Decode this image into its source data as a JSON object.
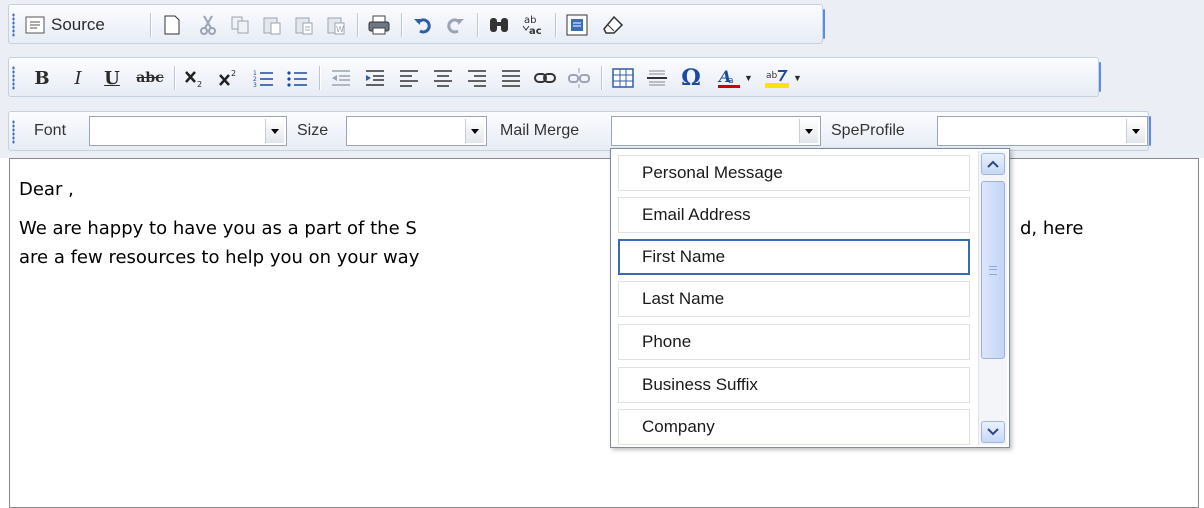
{
  "toolbar": {
    "source_label": "Source",
    "font_label": "Font",
    "size_label": "Size",
    "mail_merge_label": "Mail Merge",
    "speprofile_label": "SpeProfile",
    "font_value": "",
    "size_value": "",
    "mail_merge_value": "",
    "speprofile_value": "",
    "bold_glyph": "B",
    "italic_glyph": "I",
    "underline_glyph": "U",
    "strike_glyph": "abc",
    "omega_glyph": "Ω",
    "icons_row1": [
      "source-icon",
      "new-page-icon",
      "cut-icon",
      "copy-icon",
      "paste-icon",
      "paste-text-icon",
      "paste-word-icon",
      "print-icon",
      "undo-icon",
      "redo-icon",
      "find-icon",
      "replace-icon",
      "select-all-icon",
      "remove-format-icon"
    ],
    "icons_row2": [
      "bold-icon",
      "italic-icon",
      "underline-icon",
      "strikethrough-icon",
      "subscript-icon",
      "superscript-icon",
      "numbered-list-icon",
      "bulleted-list-icon",
      "outdent-icon",
      "indent-icon",
      "align-left-icon",
      "align-center-icon",
      "align-right-icon",
      "justify-icon",
      "link-icon",
      "unlink-icon",
      "table-icon",
      "horizontal-rule-icon",
      "special-char-icon",
      "text-color-icon",
      "bg-color-icon"
    ]
  },
  "editor": {
    "greeting": "Dear ,",
    "para_line1": "We are happy to have you as a part of the S",
    "para_line1_tail": "d, here",
    "para_line2": "are a few resources to help you on your way"
  },
  "mail_merge_dropdown": {
    "selected_index": 2,
    "items": [
      "Personal Message",
      "Email Address",
      "First Name",
      "Last Name",
      "Phone",
      "Business Suffix",
      "Company"
    ]
  },
  "colors": {
    "toolbar_bg": "#ebeef4",
    "toolbar_accent": "#5b8ee0",
    "selected_border": "#3a69b8",
    "text_color_bar": "#cc0000",
    "highlight_bar": "#ffe400"
  }
}
